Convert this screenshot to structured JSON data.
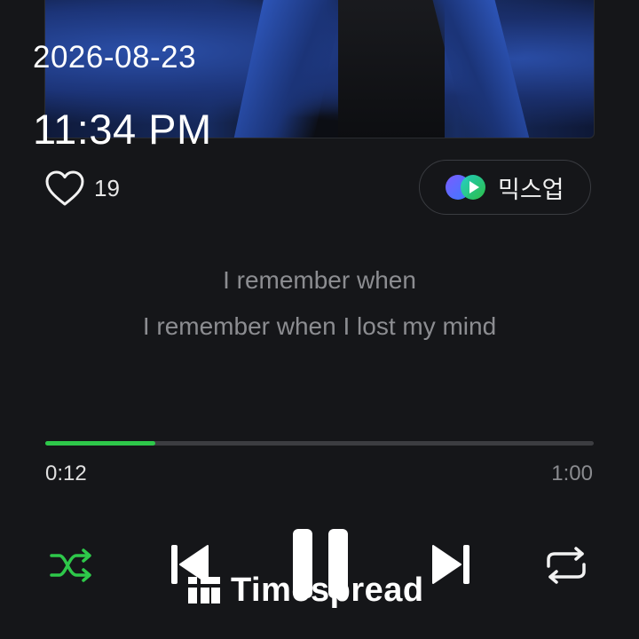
{
  "status": {
    "date": "2026-08-23",
    "time": "11:34 PM"
  },
  "album_art": {
    "icon": "album-cover-image"
  },
  "actions": {
    "like_icon": "heart-outline-icon",
    "like_count": "19",
    "mixup_icon": "mixup-logo-icon",
    "mixup_label": "믹스업"
  },
  "lyrics": {
    "line1": "I remember when",
    "line2": "I remember when I lost my mind"
  },
  "playback": {
    "progress_fraction": 0.2,
    "current_time": "0:12",
    "total_time": "1:00"
  },
  "controls": {
    "shuffle_icon": "shuffle-icon",
    "previous_icon": "skip-previous-icon",
    "pause_icon": "pause-icon",
    "next_icon": "skip-next-icon",
    "repeat_icon": "repeat-icon"
  },
  "watermark": {
    "text": "Timespread"
  },
  "colors": {
    "background": "#151619",
    "accent_green": "#2ec84a",
    "lyric_text": "#8c8d91",
    "track": "#3c3d41"
  }
}
